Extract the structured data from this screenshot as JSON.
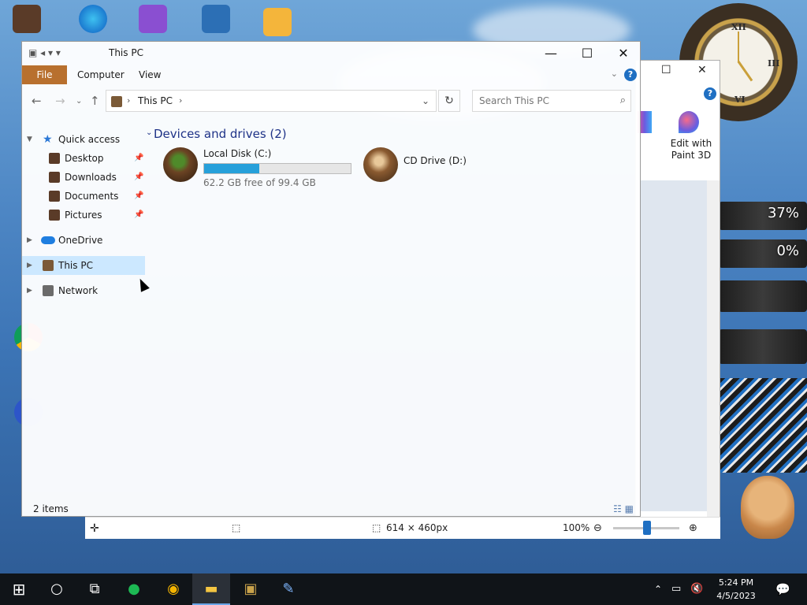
{
  "explorer": {
    "title": "This PC",
    "ribbon_tabs": [
      "File",
      "Computer",
      "View"
    ],
    "address": {
      "location": "This PC"
    },
    "search_placeholder": "Search This PC",
    "nav_items": [
      {
        "label": "Quick access",
        "kind": "group"
      },
      {
        "label": "Desktop",
        "kind": "pinned"
      },
      {
        "label": "Downloads",
        "kind": "pinned"
      },
      {
        "label": "Documents",
        "kind": "pinned"
      },
      {
        "label": "Pictures",
        "kind": "pinned"
      },
      {
        "label": "OneDrive",
        "kind": "group"
      },
      {
        "label": "This PC",
        "kind": "group",
        "selected": true
      },
      {
        "label": "Network",
        "kind": "group"
      }
    ],
    "group_heading": "Devices and drives (2)",
    "drives": [
      {
        "name": "Local Disk (C:)",
        "free_text": "62.2 GB free of 99.4 GB",
        "used_fraction": 0.374
      },
      {
        "name": "CD Drive (D:)"
      }
    ],
    "status_count": "2 items"
  },
  "paint": {
    "tool_label": "Edit with Paint 3D",
    "dimensions": "614 × 460px",
    "zoom": "100%"
  },
  "gauges": [
    "37%",
    "0%"
  ],
  "taskbar": {
    "time": "5:24 PM",
    "date": "4/5/2023"
  },
  "colors": {
    "file_tab": "#b8702e",
    "accent": "#26a0da",
    "selection": "#cce8ff",
    "heading": "#1e3287"
  }
}
